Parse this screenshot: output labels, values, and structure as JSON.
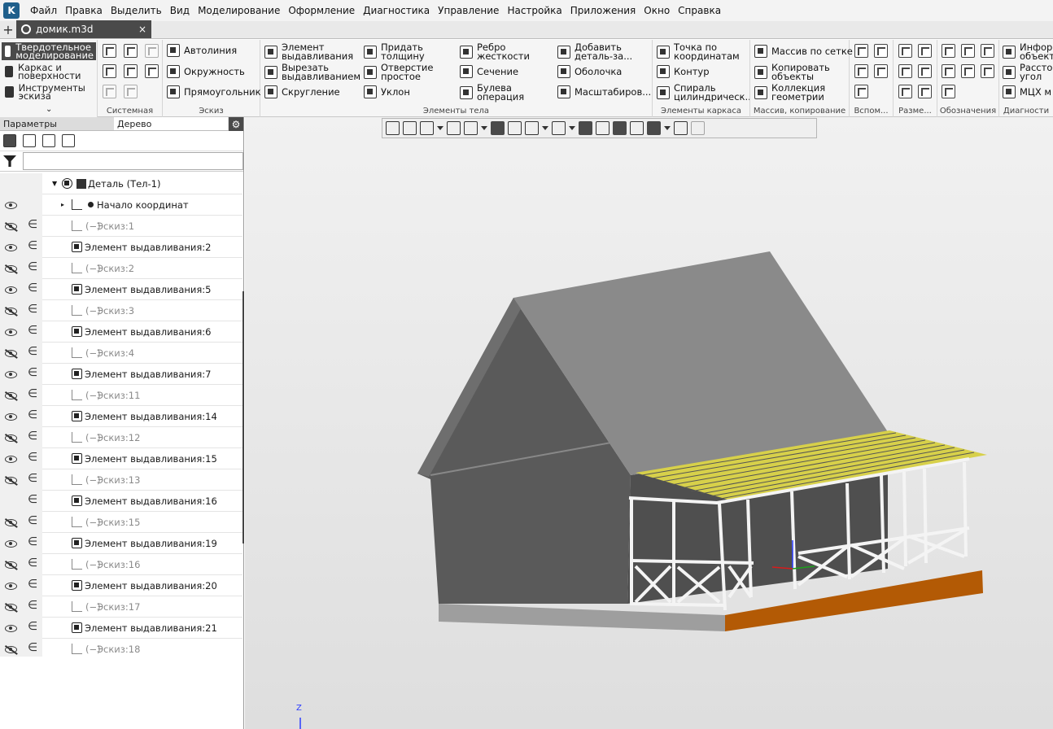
{
  "menu": [
    "Файл",
    "Правка",
    "Выделить",
    "Вид",
    "Моделирование",
    "Оформление",
    "Диагностика",
    "Управление",
    "Настройка",
    "Приложения",
    "Окно",
    "Справка"
  ],
  "tab": {
    "title": "домик.m3d",
    "close": "×",
    "add": "+"
  },
  "modes": [
    {
      "label": "Твердотельное моделирование",
      "active": true
    },
    {
      "label": "Каркас и поверхности",
      "active": false
    },
    {
      "label": "Инструменты эскиза",
      "active": false
    }
  ],
  "ribbon": {
    "system": {
      "title": "Системная"
    },
    "sketch": {
      "title": "Эскиз",
      "items": [
        "Автолиния",
        "Окружность",
        "Прямоугольник"
      ]
    },
    "body": {
      "title": "Элементы тела",
      "items": [
        "Элемент выдавливания",
        "Вырезать выдавливанием",
        "Скругление",
        "Придать толщину",
        "Отверстие простое",
        "Уклон",
        "Ребро жесткости",
        "Сечение",
        "Булева операция",
        "Добавить деталь-за...",
        "Оболочка",
        "Масштабиров..."
      ]
    },
    "frame": {
      "title": "Элементы каркаса",
      "items": [
        "Точка по координатам",
        "Контур",
        "Спираль цилиндрическ..."
      ]
    },
    "array": {
      "title": "Массив, копирование",
      "items": [
        "Массив по сетке",
        "Копировать объекты",
        "Коллекция геометрии"
      ]
    },
    "aux": {
      "title": "Вспом..."
    },
    "dims": {
      "title": "Разме..."
    },
    "notes": {
      "title": "Обозначения"
    },
    "diag": {
      "title": "Диагности",
      "items": [
        "Инфор объект",
        "Рассто угол",
        "МЦХ м"
      ]
    }
  },
  "panel": {
    "tab_params": "Параметры",
    "tab_tree": "Дерево",
    "gear": "⚙",
    "search_placeholder": ""
  },
  "tree": {
    "root": "Деталь (Тел-1)",
    "origin": "Начало координат",
    "rows": [
      {
        "label": "Эскиз:1",
        "type": "sketch",
        "eye": "hidden"
      },
      {
        "label": "Элемент выдавливания:2",
        "type": "extrude",
        "eye": "visible"
      },
      {
        "label": "Эскиз:2",
        "type": "sketch",
        "eye": "hidden"
      },
      {
        "label": "Элемент выдавливания:5",
        "type": "extrude",
        "eye": "visible"
      },
      {
        "label": "Эскиз:3",
        "type": "sketch",
        "eye": "hidden"
      },
      {
        "label": "Элемент выдавливания:6",
        "type": "extrude",
        "eye": "visible"
      },
      {
        "label": "Эскиз:4",
        "type": "sketch",
        "eye": "hidden"
      },
      {
        "label": "Элемент выдавливания:7",
        "type": "extrude",
        "eye": "visible"
      },
      {
        "label": "Эскиз:11",
        "type": "sketch",
        "eye": "hidden"
      },
      {
        "label": "Элемент выдавливания:14",
        "type": "extrude",
        "eye": "visible"
      },
      {
        "label": "Эскиз:12",
        "type": "sketch",
        "eye": "hidden"
      },
      {
        "label": "Элемент выдавливания:15",
        "type": "extrude",
        "eye": "visible"
      },
      {
        "label": "Эскиз:13",
        "type": "sketch",
        "eye": "hidden"
      },
      {
        "label": "Элемент выдавливания:16",
        "type": "extrude",
        "eye": "none"
      },
      {
        "label": "Эскиз:15",
        "type": "sketch",
        "eye": "hidden"
      },
      {
        "label": "Элемент выдавливания:19",
        "type": "extrude",
        "eye": "visible"
      },
      {
        "label": "Эскиз:16",
        "type": "sketch",
        "eye": "hidden"
      },
      {
        "label": "Элемент выдавливания:20",
        "type": "extrude",
        "eye": "visible"
      },
      {
        "label": "Эскиз:17",
        "type": "sketch",
        "eye": "hidden"
      },
      {
        "label": "Элемент выдавливания:21",
        "type": "extrude",
        "eye": "visible"
      },
      {
        "label": "Эскиз:18",
        "type": "sketch",
        "eye": "hidden"
      }
    ]
  },
  "viewport": {
    "axis_label": "Z"
  },
  "colors": {
    "floor": "#b35a05",
    "roof_deck": "#d7d04a",
    "walls": "#5a5a5a",
    "roof": "#8a8a8a"
  }
}
